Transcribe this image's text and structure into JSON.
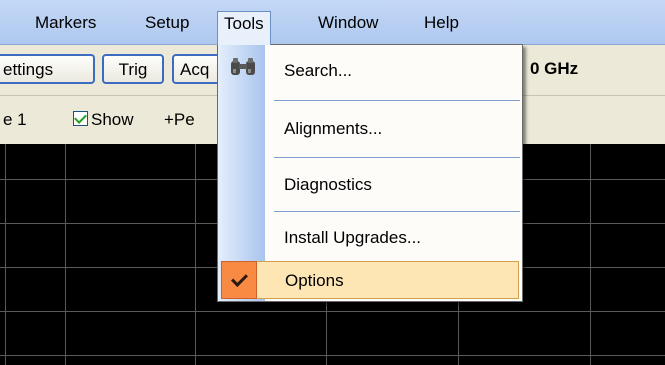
{
  "menubar": {
    "items": [
      "Markers",
      "Setup",
      "Tools",
      "Window",
      "Help"
    ],
    "open": "Tools"
  },
  "toolbar": {
    "buttons": [
      "ettings",
      "Trig",
      "Acq"
    ],
    "frequency": "0 GHz"
  },
  "trace": {
    "label": "e 1",
    "show_label": "Show",
    "show_checked": true,
    "peak_label": "+Pe"
  },
  "tools_menu": {
    "items": [
      {
        "label": "Search...",
        "icon": "binoculars-icon"
      },
      {
        "label": "Alignments..."
      },
      {
        "label": "Diagnostics"
      },
      {
        "label": "Install Upgrades..."
      },
      {
        "label": "Options",
        "checked": true,
        "highlighted": true
      }
    ]
  },
  "colors": {
    "menubar": "#b8cff2",
    "highlight": "#fde6b4",
    "check_background": "#f98a44",
    "plot_background": "#000000",
    "grid": "#595959"
  }
}
